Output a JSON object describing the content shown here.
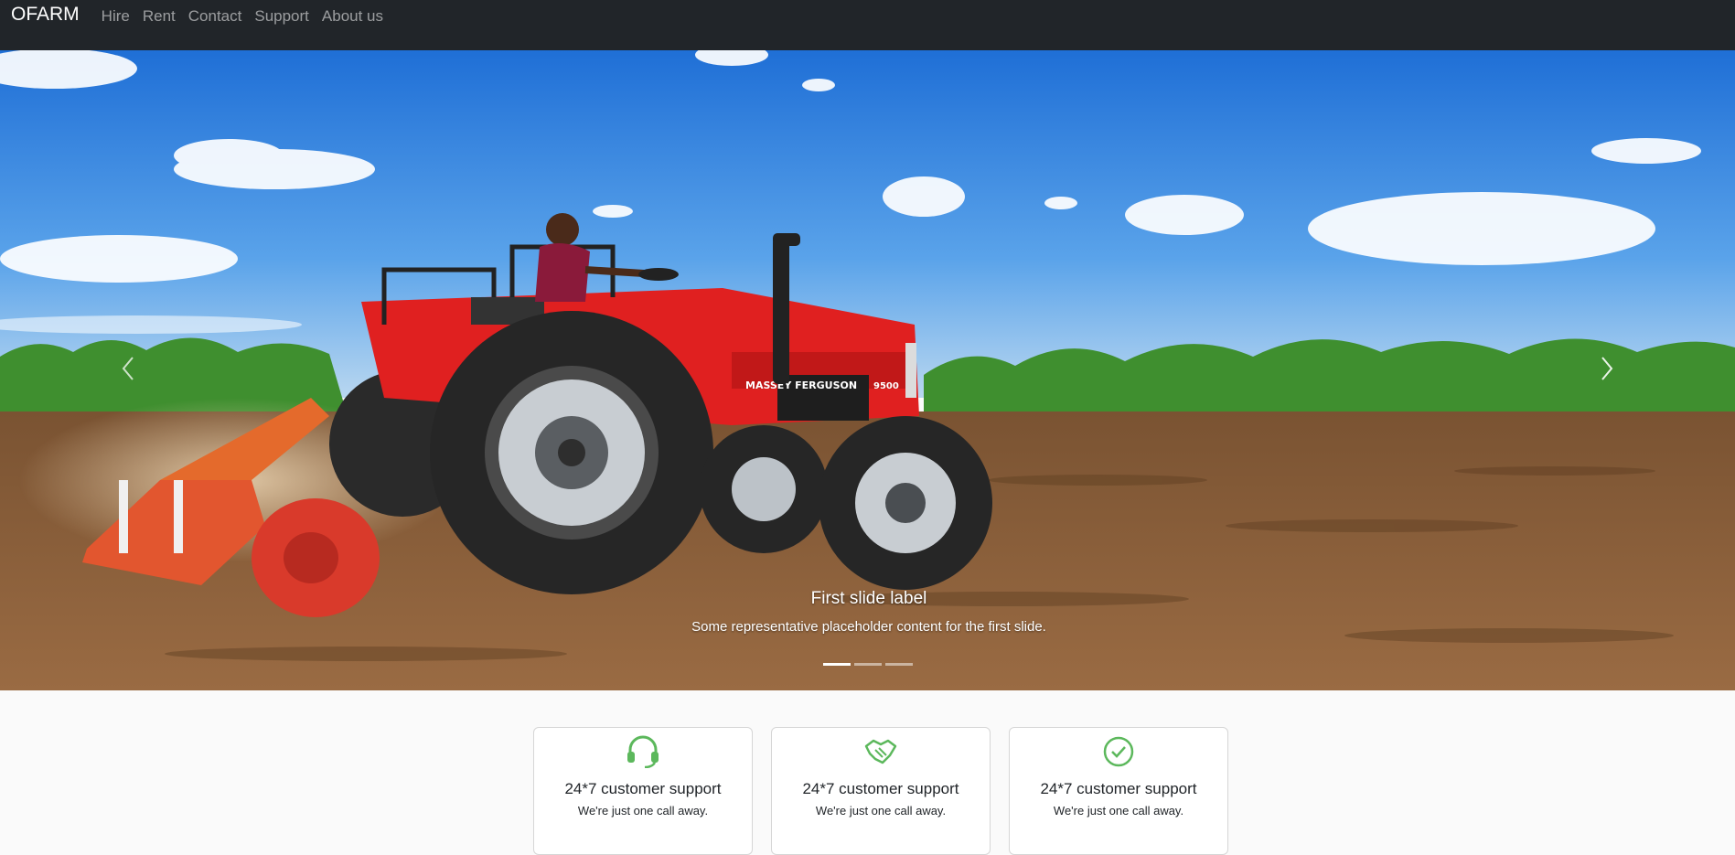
{
  "navbar": {
    "brand": "OFARM",
    "links": [
      "Hire",
      "Rent",
      "Contact",
      "Support",
      "About us"
    ]
  },
  "carousel": {
    "slide_label": "First slide label",
    "slide_text": "Some representative placeholder content for the first slide.",
    "tractor_text": "MASSEY FERGUSON",
    "tractor_model": "9500",
    "slide_count": 3,
    "active_slide": 1
  },
  "features": [
    {
      "icon": "headset-icon",
      "title": "24*7 customer support",
      "desc": "We're just one call away."
    },
    {
      "icon": "handshake-icon",
      "title": "24*7 customer support",
      "desc": "We're just one call away."
    },
    {
      "icon": "check-circle-icon",
      "title": "24*7 customer support",
      "desc": "We're just one call away."
    }
  ],
  "colors": {
    "navbar_bg": "#212529",
    "accent_green": "#5cb85c",
    "sky": "#3a8be0",
    "soil": "#8a5a36"
  }
}
